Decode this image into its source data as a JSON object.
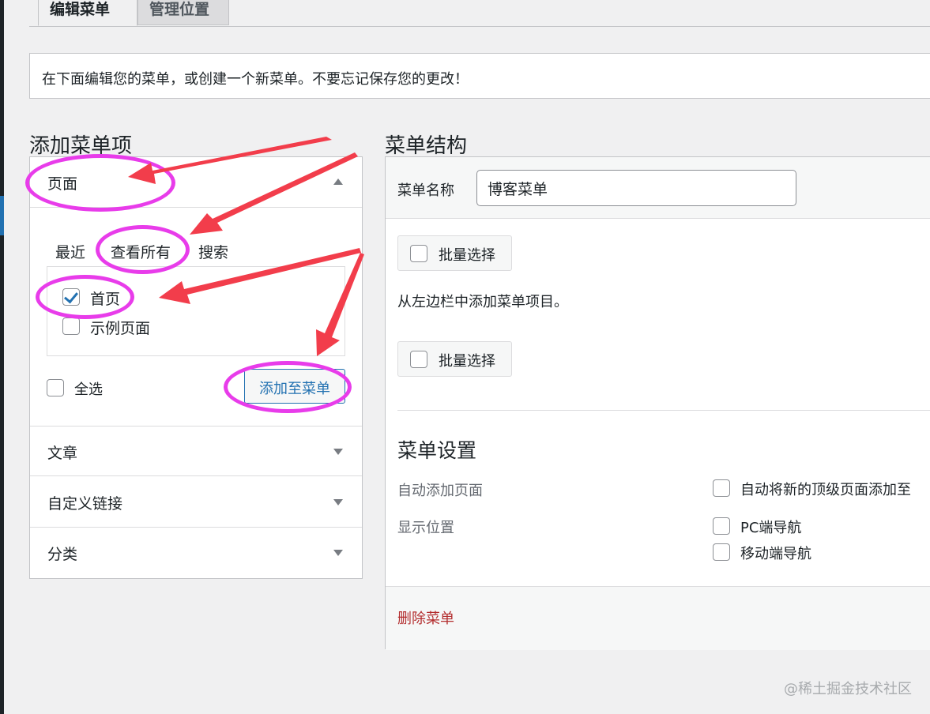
{
  "tabs": {
    "edit": "编辑菜单",
    "manage": "管理位置"
  },
  "notice": "在下面编辑您的菜单，或创建一个新菜单。不要忘记保存您的更改！",
  "add_items": {
    "title": "添加菜单项",
    "sections": [
      "页面",
      "文章",
      "自定义链接",
      "分类"
    ],
    "subtabs": [
      "最近",
      "查看所有",
      "搜索"
    ],
    "pages": [
      {
        "label": "首页",
        "checked": true
      },
      {
        "label": "示例页面",
        "checked": false
      }
    ],
    "select_all": "全选",
    "add_button": "添加至菜单"
  },
  "structure": {
    "title": "菜单结构",
    "name_label": "菜单名称",
    "name_value": "博客菜单",
    "bulk_select": "批量选择",
    "hint": "从左边栏中添加菜单项目。",
    "settings_title": "菜单设置",
    "auto_add_label": "自动添加页面",
    "auto_add_option": "自动将新的顶级页面添加至",
    "location_label": "显示位置",
    "locations": [
      "PC端导航",
      "移动端导航"
    ],
    "delete": "删除菜单"
  },
  "watermark": "@稀土掘金技术社区",
  "colors": {
    "accent": "#2271b1",
    "annotation_circle": "#e83cea",
    "annotation_arrow": "#f23d4b",
    "delete_link": "#b32d2e"
  }
}
